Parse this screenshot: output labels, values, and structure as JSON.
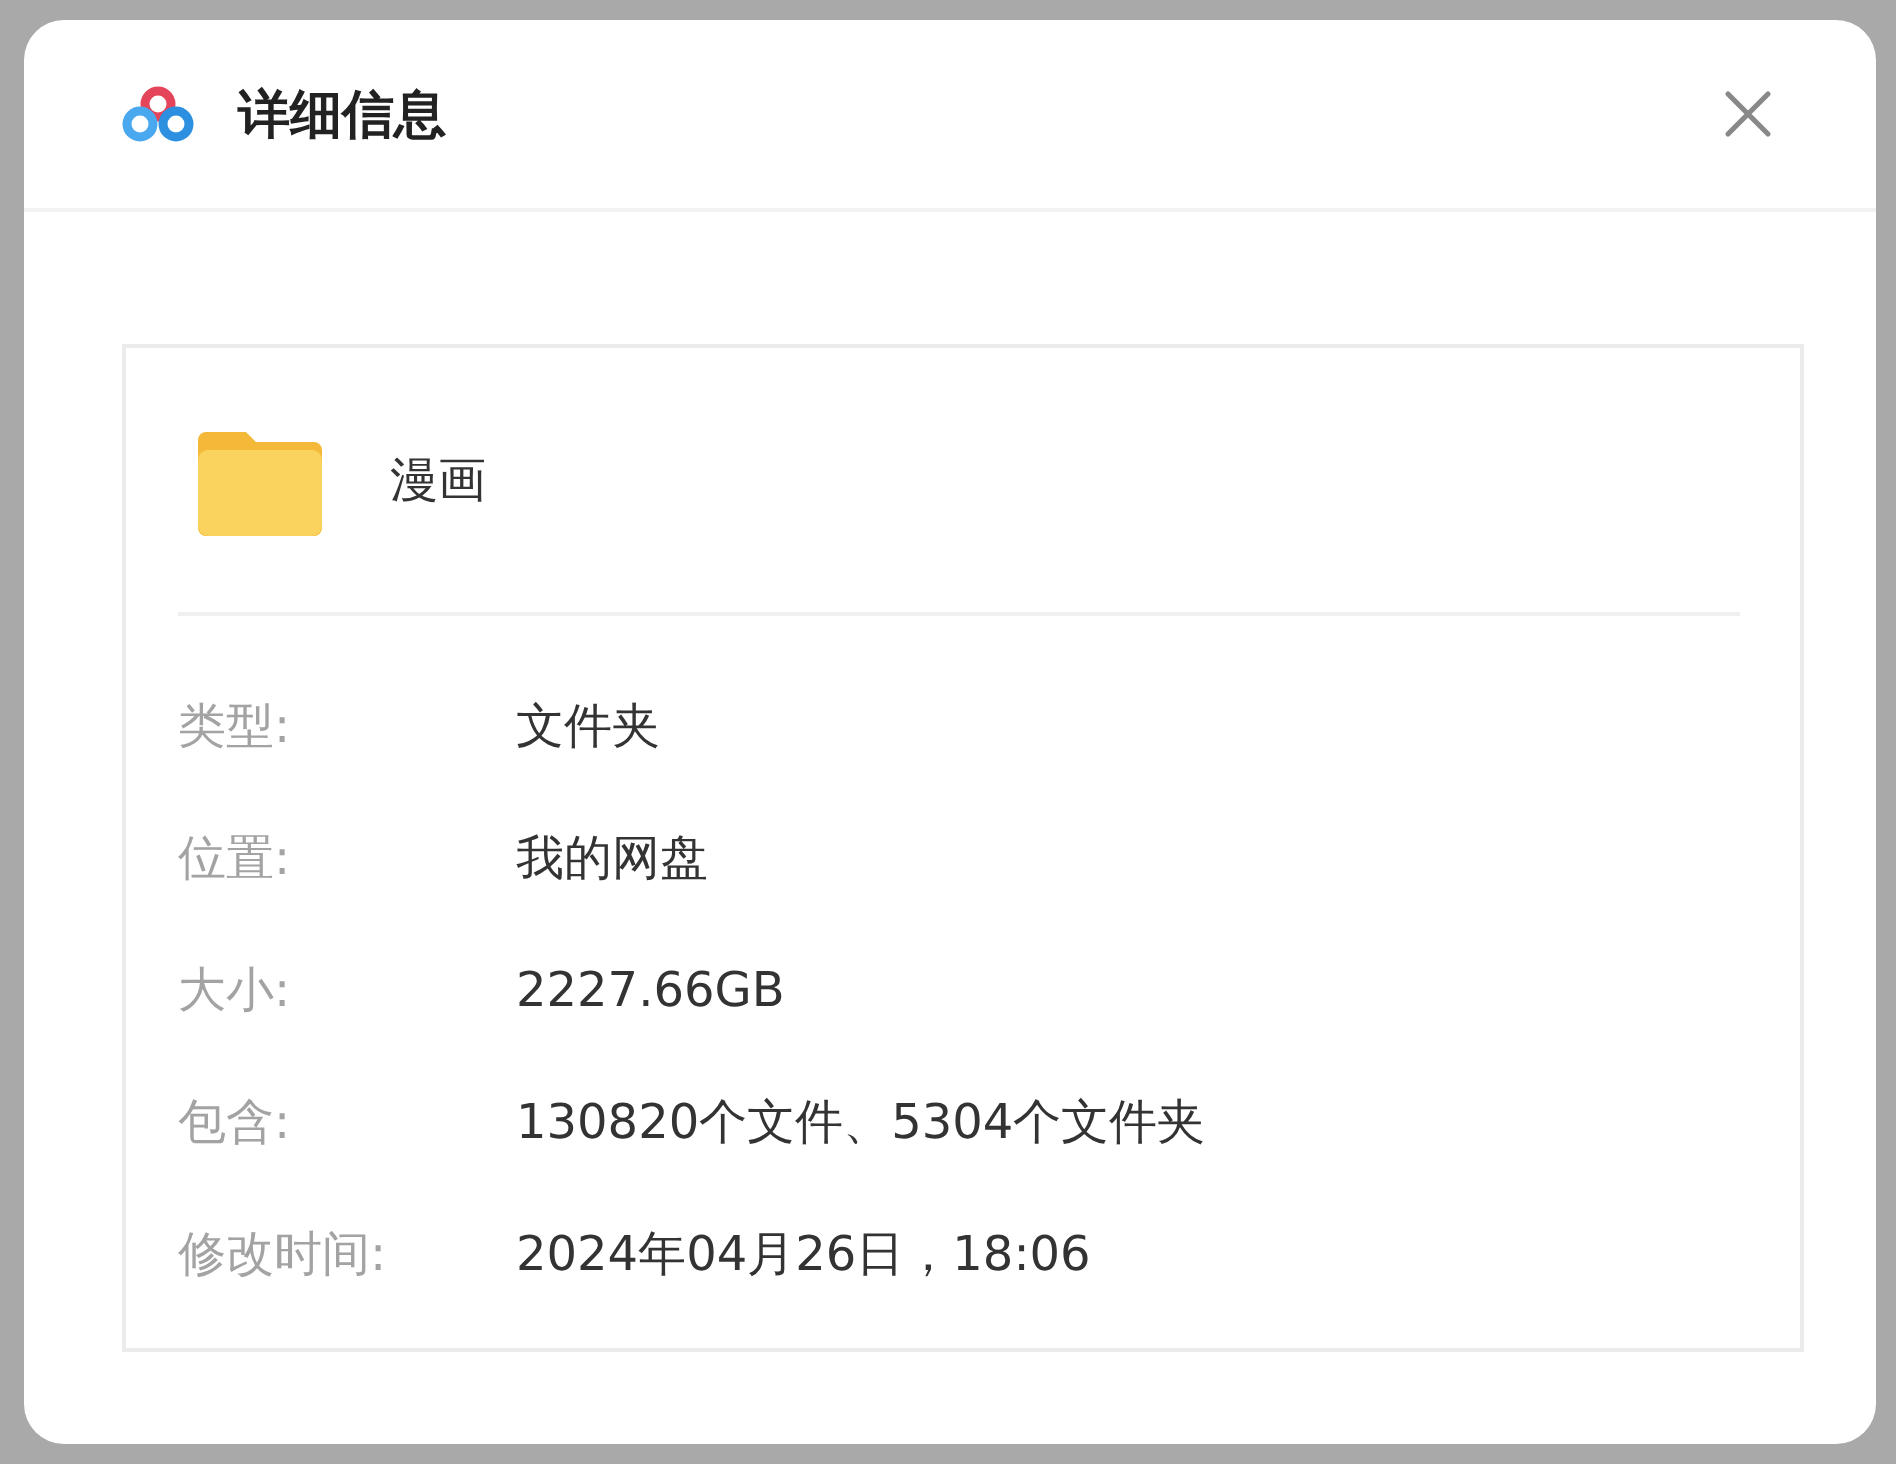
{
  "dialog": {
    "title": "详细信息"
  },
  "item": {
    "name": "漫画"
  },
  "properties": [
    {
      "label": "类型:",
      "value": "文件夹"
    },
    {
      "label": "位置:",
      "value": "我的网盘"
    },
    {
      "label": "大小:",
      "value": "2227.66GB"
    },
    {
      "label": "包含:",
      "value": "130820个文件、5304个文件夹"
    },
    {
      "label": "修改时间:",
      "value": "2024年04月26日，18:06"
    }
  ]
}
